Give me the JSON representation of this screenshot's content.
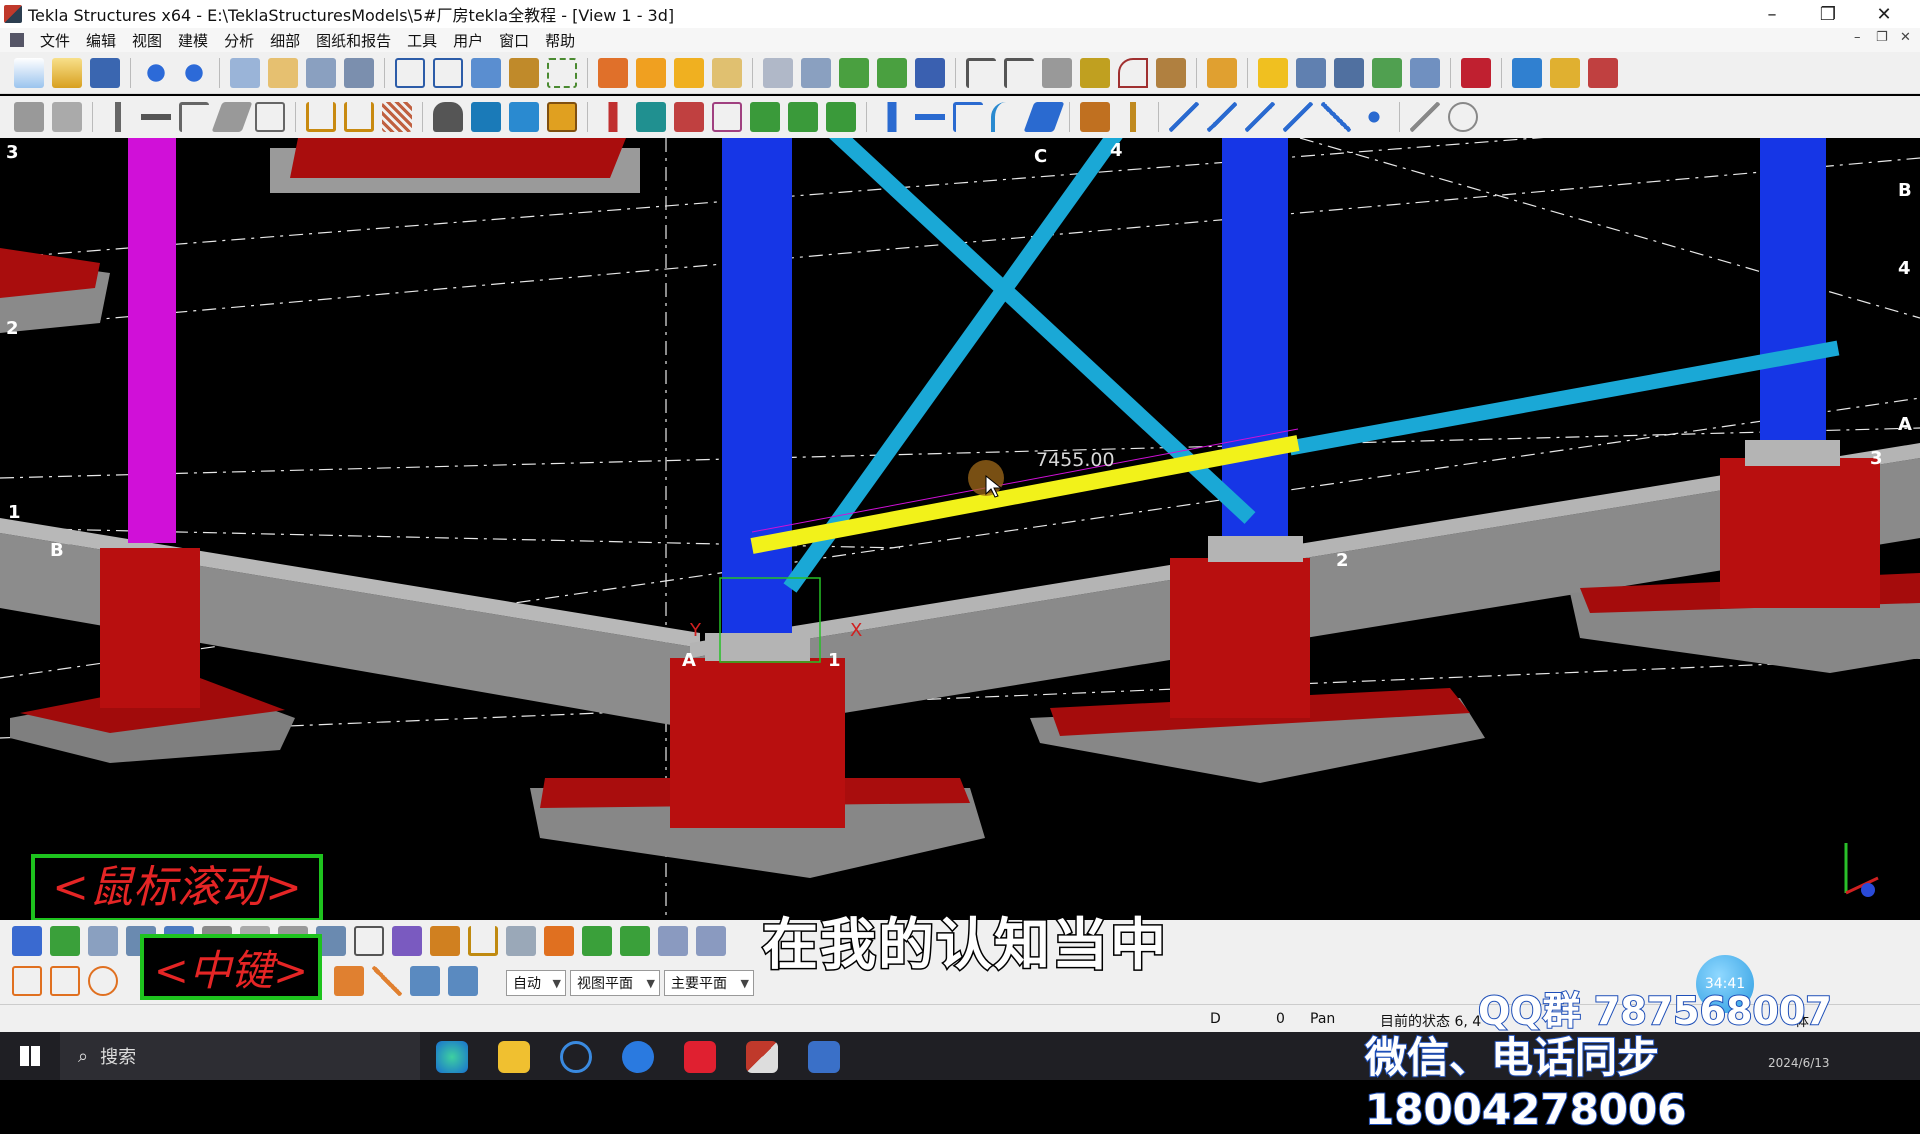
{
  "window": {
    "title": "Tekla Structures x64 - E:\\TeklaStructuresModels\\5#厂房tekla全教程 - [View 1 - 3d]",
    "minimize": "–",
    "restore": "❐",
    "close": "✕"
  },
  "menu": [
    "文件",
    "编辑",
    "视图",
    "建模",
    "分析",
    "细部",
    "图纸和报告",
    "工具",
    "用户",
    "窗口",
    "帮助"
  ],
  "viewport": {
    "dimension_label": "7455.00",
    "grid_labels": {
      "g3_left": "3",
      "g2_left": "2",
      "g1_left": "1",
      "gB_left": "B",
      "gC_top": "C",
      "g4_top": "4",
      "gB_right": "B",
      "g4_right": "4",
      "gA_right": "A",
      "g3_right": "3",
      "gA_mid": "A",
      "g1_mid": "1",
      "g2_mid": "2"
    },
    "axis_x": "X",
    "axis_y": "Y"
  },
  "bottom": {
    "select_auto": "自动",
    "select_view_plane": "视图平面",
    "select_main_plane": "主要平面"
  },
  "status": {
    "d_label": "D",
    "d_value": "0",
    "mode": "Pan",
    "current_state": "目前的状态 6, 4",
    "tail": "体"
  },
  "taskbar": {
    "search_placeholder": "搜索",
    "clock_date": "2024/6/13"
  },
  "overlays": {
    "mouse_scroll": "<鼠标滚动>",
    "middle_button": "<中键>",
    "subtitle": "在我的认知当中",
    "qq_group": "QQ群 787568007",
    "wechat_phone": "微信、电话同步18004278006",
    "timer": "34:41"
  },
  "colors": {
    "column_blue": "#1636e6",
    "column_magenta": "#d010d8",
    "brace_cyan": "#1aa8d6",
    "selected_beam": "#f2f21a",
    "pedestal_red": "#b80f0f",
    "footing_gray": "#8a8a8a",
    "overlay_green": "#1ec31e",
    "overlay_red": "#e52525"
  }
}
